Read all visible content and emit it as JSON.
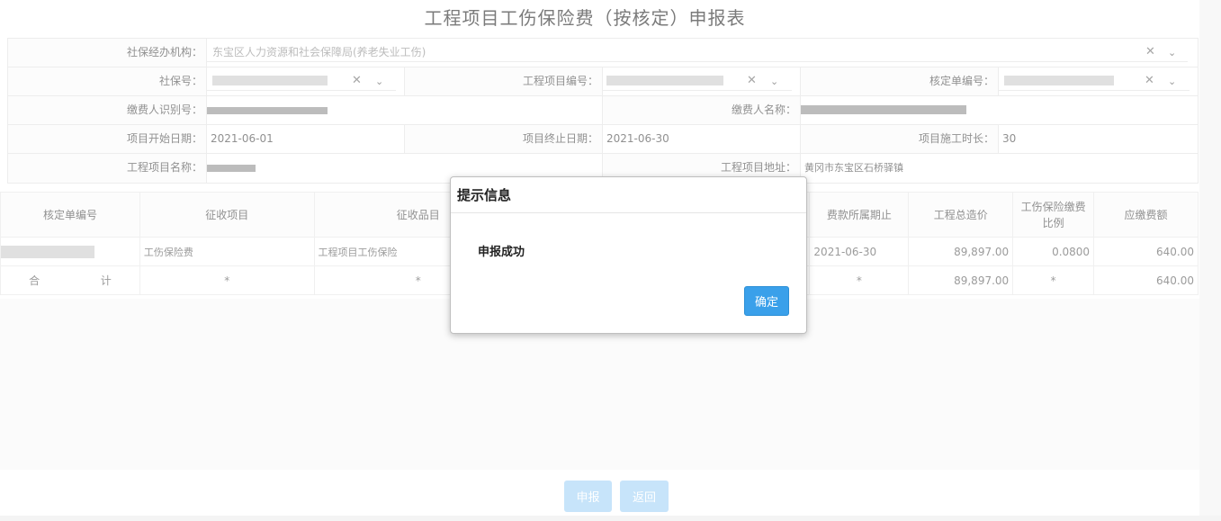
{
  "title": "工程项目工伤保险费（按核定）申报表",
  "form": {
    "agency_label": "社保经办机构：",
    "agency_value": "东宝区人力资源和社会保障局(养老失业工伤)",
    "ssn_label": "社保号：",
    "project_no_label": "工程项目编号：",
    "assess_no_label": "核定单编号：",
    "payer_id_label": "缴费人识别号：",
    "payer_name_label": "缴费人名称：",
    "start_label": "项目开始日期：",
    "start_value": "2021-06-01",
    "end_label": "项目终止日期：",
    "end_value": "2021-06-30",
    "duration_label": "项目施工时长：",
    "duration_value": "30",
    "project_name_label": "工程项目名称：",
    "project_addr_label": "工程项目地址：",
    "project_addr_value": "黄冈市东宝区石桥驿镇"
  },
  "table": {
    "headers": {
      "assess_no": "核定单编号",
      "levy_item": "征收项目",
      "levy_sub": "征收品目",
      "period_end": "费款所属期止",
      "total_cost": "工程总造价",
      "ratio": "工伤保险缴费比例",
      "due": "应缴费额"
    },
    "row": {
      "levy_item": "工伤保险费",
      "levy_sub": "工程项目工伤保险",
      "period_end": "2021-06-30",
      "total_cost": "89,897.00",
      "ratio": "0.0800",
      "due": "640.00"
    },
    "total": {
      "label_a": "合",
      "label_b": "计",
      "levy_item": "*",
      "levy_sub": "*",
      "period_end": "*",
      "total_cost": "89,897.00",
      "ratio": "*",
      "due": "640.00"
    }
  },
  "buttons": {
    "submit": "申报",
    "back": "返回"
  },
  "dialog": {
    "title": "提示信息",
    "message": "申报成功",
    "ok": "确定"
  },
  "icons": {
    "clear": "close-x-icon",
    "dropdown": "chevron-down-icon"
  }
}
